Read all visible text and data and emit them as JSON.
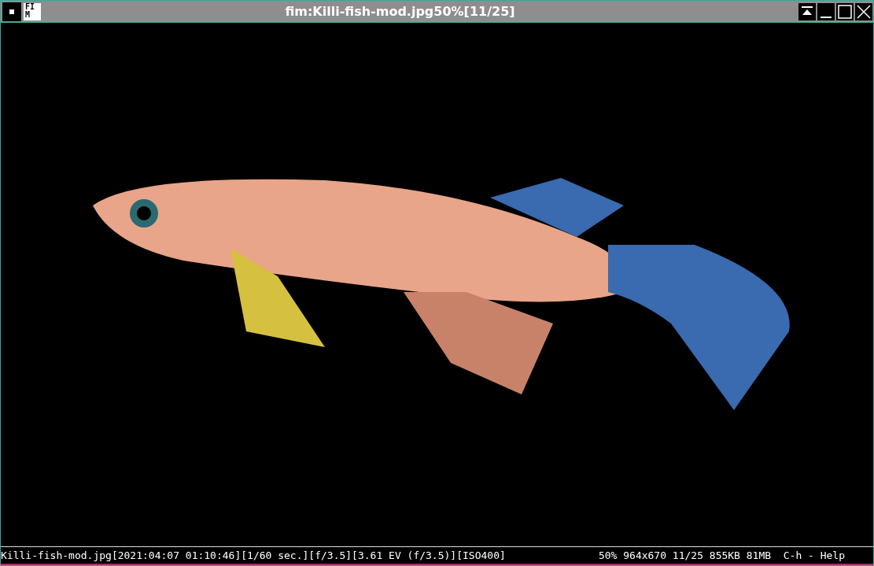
{
  "window": {
    "title": "fim:Killi-fish-mod.jpg50%[11/25]",
    "app_icon_lines": [
      "FI",
      "M"
    ]
  },
  "status_bar": {
    "left": "Killi-fish-mod.jpg[2021:04:07 01:10:46][1/60 sec.][f/3.5][3.61 EV (f/3.5)][ISO400]",
    "right": "50% 964x670 11/25 855KB 81MB  C-h - Help"
  }
}
